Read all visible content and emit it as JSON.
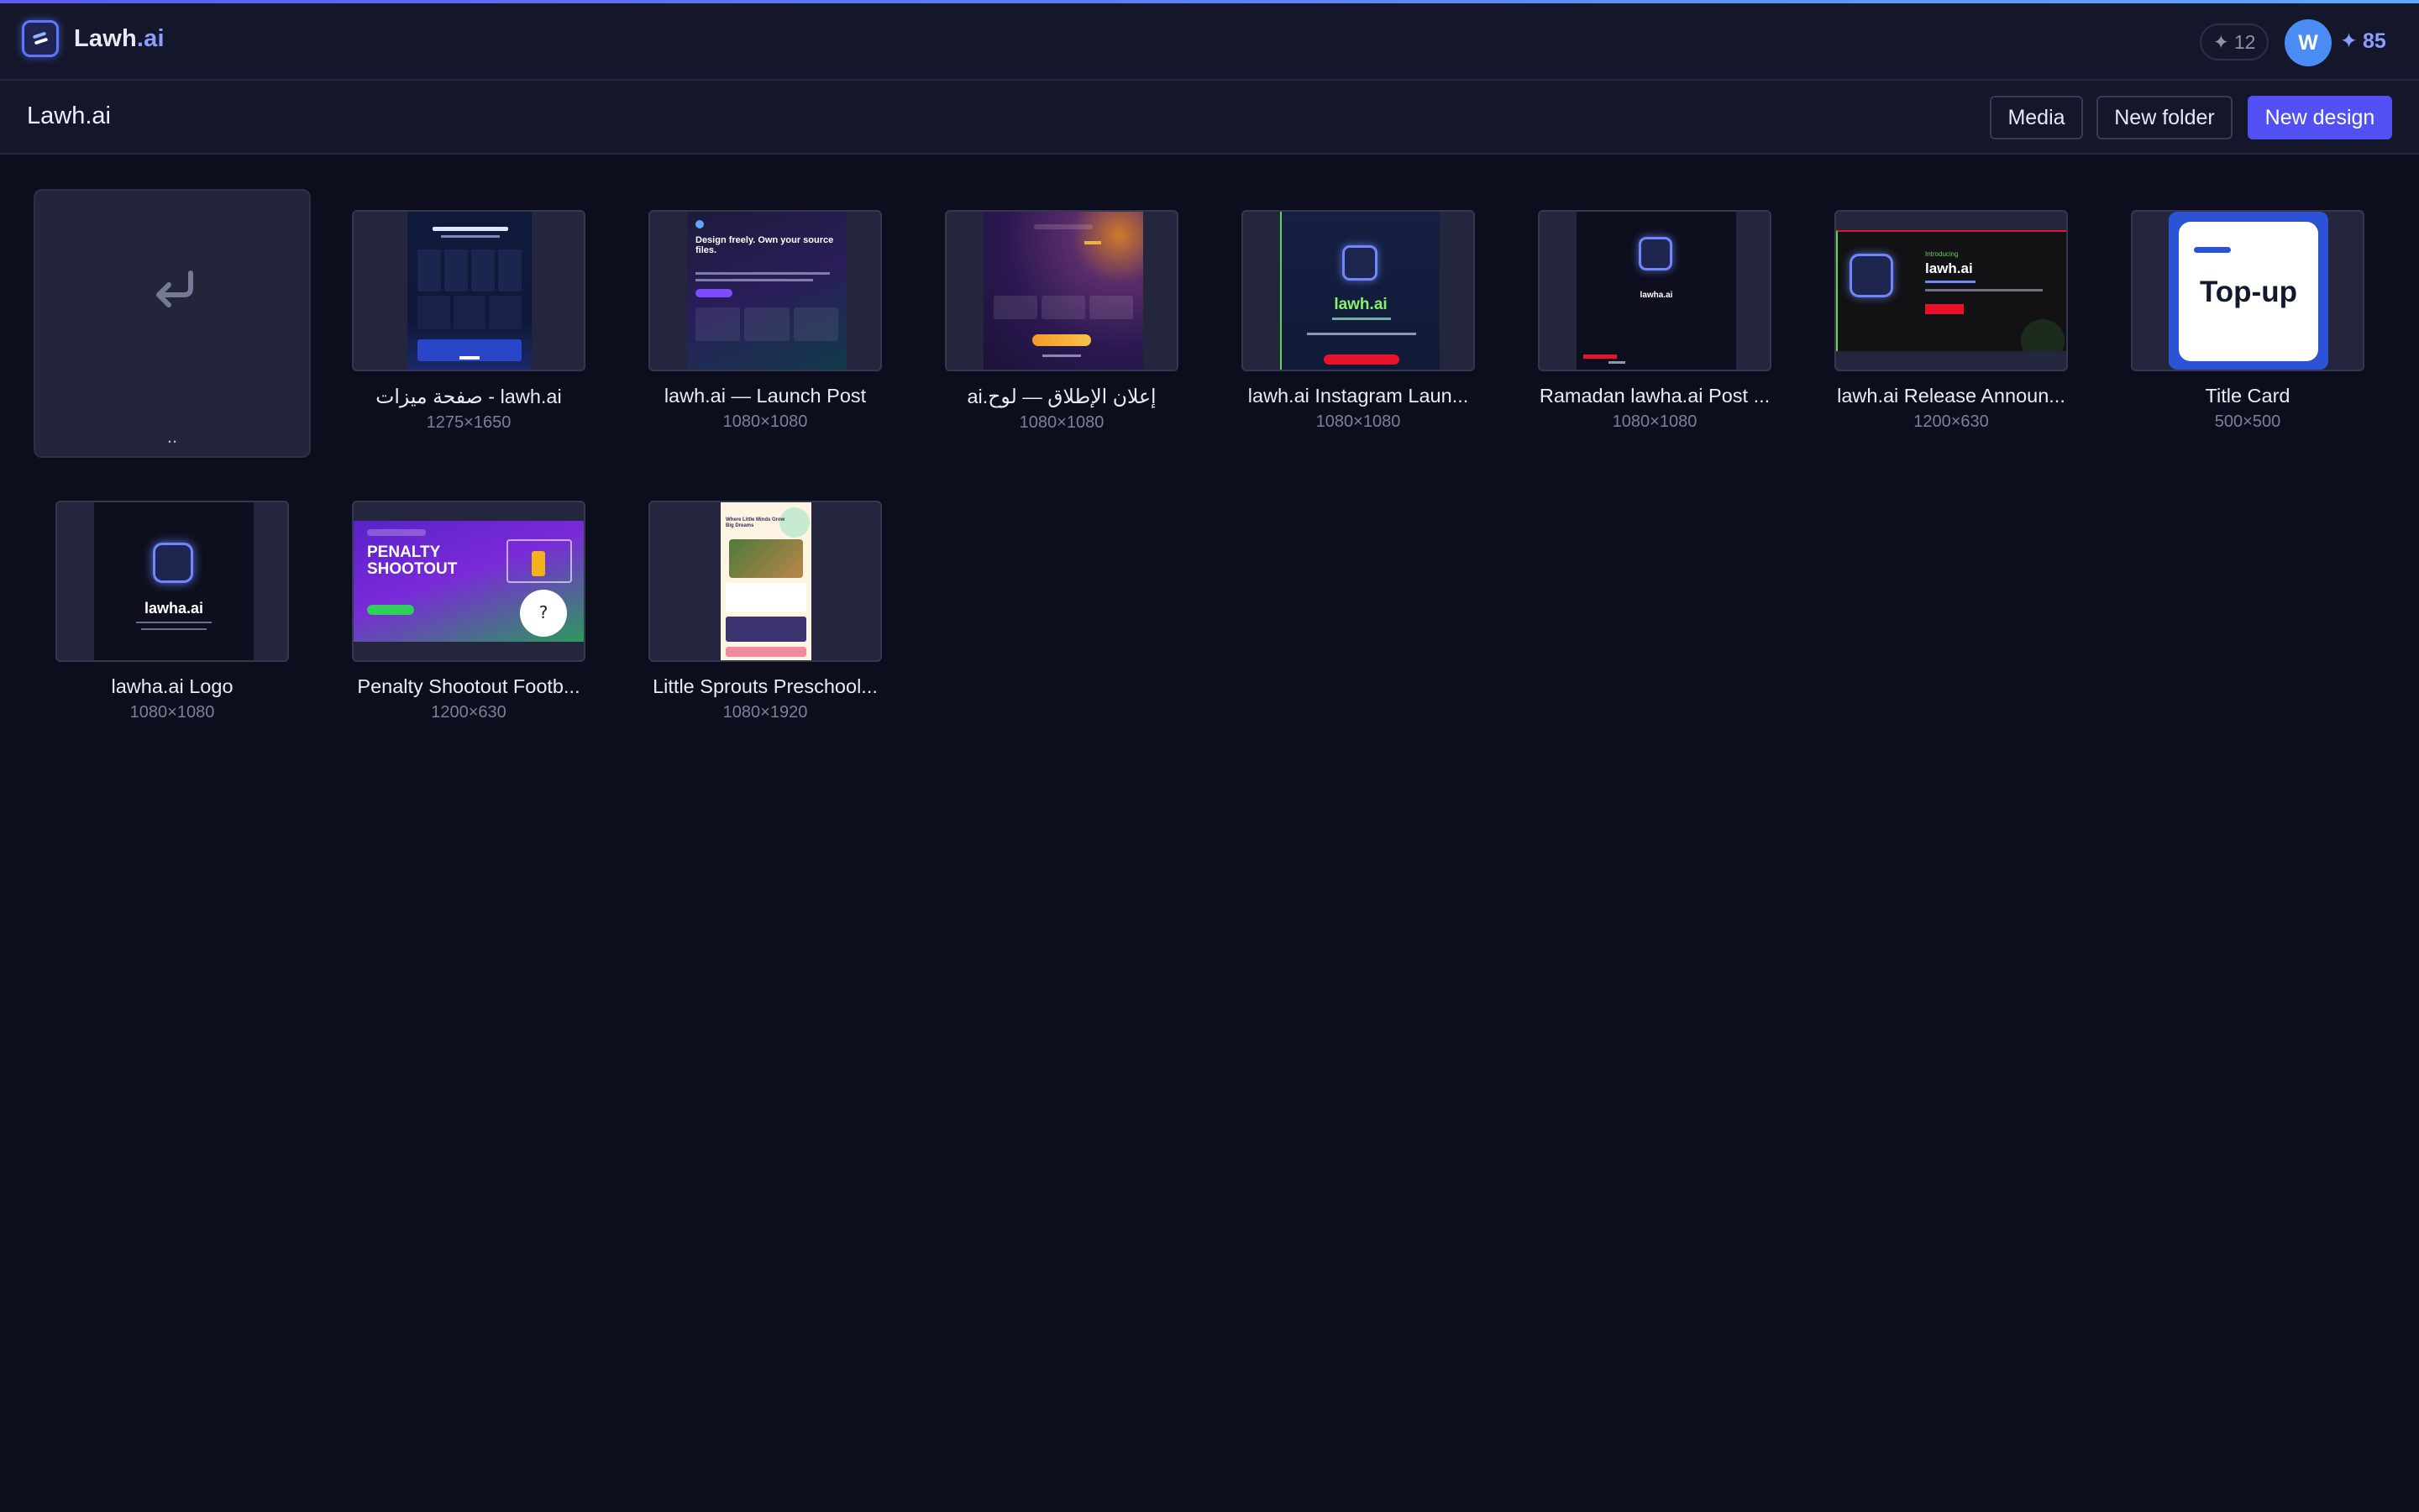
{
  "app": {
    "brand_main": "Lawh",
    "brand_accent": ".ai",
    "credits": "12",
    "avatar_initial": "W",
    "points": "85"
  },
  "toolbar": {
    "title": "Lawh.ai",
    "media_label": "Media",
    "new_folder_label": "New folder",
    "new_design_label": "New design"
  },
  "back_tile": {
    "label": ".."
  },
  "designs": [
    {
      "name": "صفحة ميزات - lawh.ai",
      "dims": "1275×1650"
    },
    {
      "name": "lawh.ai — Launch Post",
      "dims": "1080×1080"
    },
    {
      "name": "إعلان الإطلاق — لوح.ai",
      "dims": "1080×1080"
    },
    {
      "name": "lawh.ai Instagram Laun...",
      "dims": "1080×1080"
    },
    {
      "name": "Ramadan lawha.ai Post ...",
      "dims": "1080×1080"
    },
    {
      "name": "lawh.ai Release Announ...",
      "dims": "1200×630"
    },
    {
      "name": "Title Card",
      "dims": "500×500"
    },
    {
      "name": "lawha.ai Logo",
      "dims": "1080×1080"
    },
    {
      "name": "Penalty Shootout Footb...",
      "dims": "1200×630"
    },
    {
      "name": "Little Sprouts Preschool...",
      "dims": "1080×1920"
    }
  ],
  "thumbs": {
    "launch_post_headline": "Design freely. Own your source files.",
    "instagram_brand": "lawh.ai",
    "ramadan_brand": "lawha.ai",
    "release_intro": "Introducing",
    "release_brand": "lawh.ai",
    "title_card_text": "Top-up",
    "logo_brand": "lawha.ai",
    "penalty_title": "PENALTY SHOOTOUT",
    "sprouts_headline": "Where Little Minds Grow Big Dreams"
  },
  "colors": {
    "background": "#0c0d1d",
    "header": "#141629",
    "accent": "#5250f2",
    "brand_accent": "#8b9dff",
    "avatar": "#4b8cf5"
  }
}
